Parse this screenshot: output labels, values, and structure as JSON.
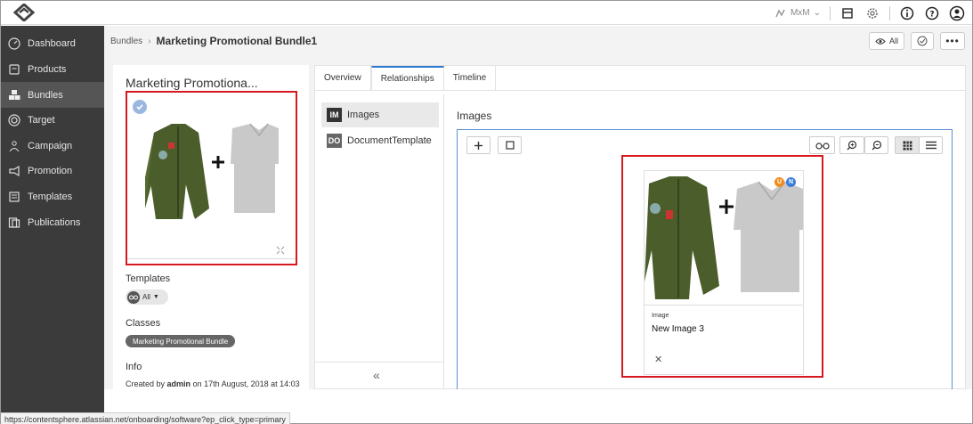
{
  "topbar": {
    "org_label": "MxM",
    "icons": [
      "package-icon",
      "gear-icon",
      "info-icon",
      "help-icon",
      "user-icon"
    ]
  },
  "sidebar": {
    "items": [
      {
        "label": "Dashboard",
        "icon": "dashboard-icon",
        "active": false
      },
      {
        "label": "Products",
        "icon": "products-icon",
        "active": false
      },
      {
        "label": "Bundles",
        "icon": "bundles-icon",
        "active": true
      },
      {
        "label": "Target",
        "icon": "target-icon",
        "active": false
      },
      {
        "label": "Campaign",
        "icon": "campaign-icon",
        "active": false
      },
      {
        "label": "Promotion",
        "icon": "megaphone-icon",
        "active": false
      },
      {
        "label": "Templates",
        "icon": "templates-icon",
        "active": false
      },
      {
        "label": "Publications",
        "icon": "publications-icon",
        "active": false
      }
    ]
  },
  "header": {
    "breadcrumb_parent": "Bundles",
    "breadcrumb_current": "Marketing Promotional Bundle1",
    "view_label": "All"
  },
  "details": {
    "title": "Marketing Promotiona...",
    "templates_label": "Templates",
    "templates_filter": "All",
    "classes_label": "Classes",
    "class_tag": "Marketing Promotional Bundle",
    "info_label": "Info",
    "created_prefix": "Created by",
    "created_user": "admin",
    "created_on": "on 17th August, 2018 at 14:03"
  },
  "tabs": [
    "Overview",
    "Relationships",
    "Timeline"
  ],
  "active_tab": "Relationships",
  "relationships": [
    {
      "abbr": "IM",
      "label": "Images"
    },
    {
      "abbr": "DO",
      "label": "DocumentTemplate"
    }
  ],
  "images_panel": {
    "heading": "Images",
    "card": {
      "type": "Image",
      "name": "New Image 3",
      "badges": [
        {
          "text": "U",
          "color": "#f08c1e"
        },
        {
          "text": "N",
          "color": "#3b7ddd"
        }
      ]
    }
  },
  "status_url": "https://contentsphere.atlassian.net/onboarding/software?ep_click_type=primary",
  "colors": {
    "sidebar_bg": "#3b3b3b",
    "accent": "#2e7ad1",
    "highlight": "#d7191f"
  }
}
